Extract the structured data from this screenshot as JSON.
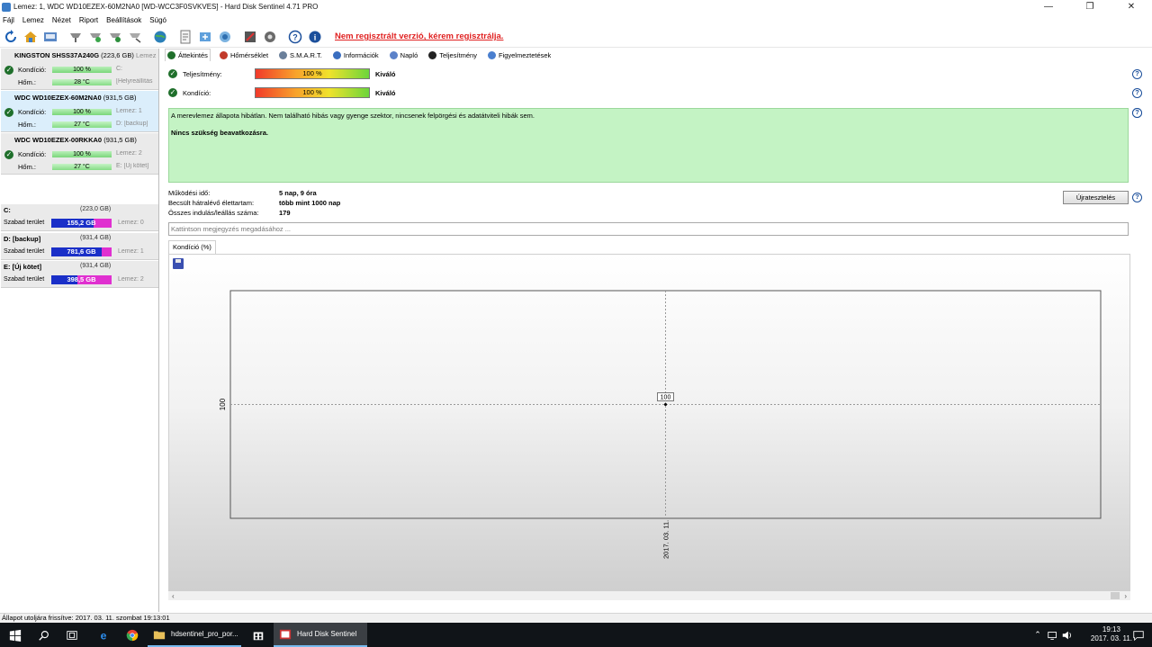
{
  "window": {
    "title": "Lemez: 1, WDC WD10EZEX-60M2NA0 [WD-WCC3F0SVKVES]  -  Hard Disk Sentinel 4.71 PRO",
    "minimize": "—",
    "restore": "❐",
    "close": "✕"
  },
  "menu": [
    "Fájl",
    "Lemez",
    "Nézet",
    "Riport",
    "Beállítások",
    "Súgó"
  ],
  "toolbar": {
    "register_link": "Nem regisztrált verzió, kérem regisztrálja."
  },
  "disks": [
    {
      "name": "KINGSTON SHSS37A240G",
      "size": "(223,6 GB)",
      "suffix": "Lemez",
      "condition_label": "Kondíció:",
      "condition": "100 %",
      "temp_label": "Hőm.:",
      "temp": "28 °C",
      "extra1": "C:",
      "extra2": "[Helyreállítás"
    },
    {
      "name": "WDC WD10EZEX-60M2NA0",
      "size": "(931,5 GB)",
      "suffix": "",
      "condition_label": "Kondíció:",
      "condition": "100 %",
      "temp_label": "Hőm.:",
      "temp": "27 °C",
      "extra1": "Lemez: 1",
      "extra2": "D: [backup]"
    },
    {
      "name": "WDC WD10EZEX-00RKKA0",
      "size": "(931,5 GB)",
      "suffix": "",
      "condition_label": "Kondíció:",
      "condition": "100 %",
      "temp_label": "Hőm.:",
      "temp": "27 °C",
      "extra1": "Lemez: 2",
      "extra2": "E: [Új kötet]"
    }
  ],
  "volumes": [
    {
      "name": "C:",
      "size": "(223,0 GB)",
      "free_label": "Szabad terület",
      "free": "155,2 GB",
      "free_fraction": 0.7,
      "disk": "Lemez: 0"
    },
    {
      "name": "D: [backup]",
      "size": "(931,4 GB)",
      "free_label": "Szabad terület",
      "free": "781,6 GB",
      "free_fraction": 0.84,
      "disk": "Lemez: 1"
    },
    {
      "name": "E: [Új kötet]",
      "size": "(931,4 GB)",
      "free_label": "Szabad terület",
      "free": "398,5 GB",
      "free_fraction": 0.43,
      "disk": "Lemez: 2"
    }
  ],
  "tabs": [
    {
      "label": "Áttekintés",
      "color": "#1f6f2b"
    },
    {
      "label": "Hőmérséklet",
      "color": "#c23a2a"
    },
    {
      "label": "S.M.A.R.T.",
      "color": "#6a7f9a"
    },
    {
      "label": "Információk",
      "color": "#3a6ec0"
    },
    {
      "label": "Napló",
      "color": "#5c82c9"
    },
    {
      "label": "Teljesítmény",
      "color": "#222222"
    },
    {
      "label": "Figyelmeztetések",
      "color": "#4a7fcf"
    }
  ],
  "overview": {
    "performance_label": "Teljesítmény:",
    "performance_value": "100 %",
    "performance_rating": "Kiváló",
    "condition_label": "Kondíció:",
    "condition_value": "100 %",
    "condition_rating": "Kiváló",
    "status_line1": "A merevlemez állapota hibátlan. Nem található hibás vagy gyenge szektor, nincsenek felpörgési és adatátviteli hibák sem.",
    "status_line2": "Nincs szükség beavatkozásra.",
    "uptime_label": "Működési idő:",
    "uptime_value": "5 nap, 9 óra",
    "lifetime_label": "Becsült hátralévő élettartam:",
    "lifetime_value": "több mint 1000 nap",
    "startstop_label": "Összes indulás/leállás száma:",
    "startstop_value": "179",
    "retest_button": "Újratesztelés",
    "note_placeholder": "Kattintson megjegyzés megadásához ...",
    "chart_tab": "Kondíció  (%)"
  },
  "chart_data": {
    "type": "line",
    "x": [
      "2017. 03. 11."
    ],
    "series": [
      {
        "values": [
          100
        ]
      }
    ],
    "data_labels": [
      "100"
    ],
    "ytick_labels": [
      "100"
    ],
    "xtick_labels": [
      "2017. 03. 11."
    ],
    "grid": true
  },
  "statusbar": {
    "text": "Állapot utoljára frissítve: 2017. 03. 11. szombat 19:13:01"
  },
  "taskbar": {
    "app1": "hdsentinel_pro_por...",
    "app2": "Hard Disk Sentinel",
    "time": "19:13",
    "date": "2017. 03. 11."
  }
}
